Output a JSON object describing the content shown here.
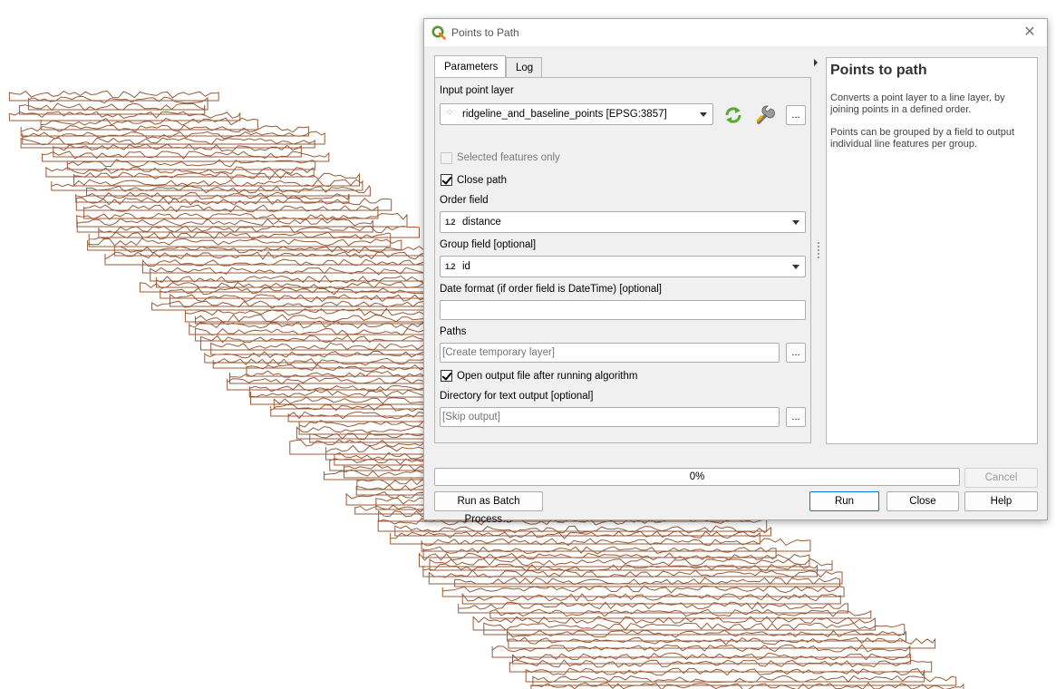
{
  "colors": {
    "profile_line": "#9a5a36",
    "qgis_green": "#589632",
    "progress_fill": "#06b025"
  },
  "map": {
    "description_icon": "map-canvas"
  },
  "dialog": {
    "title": "Points to Path",
    "close_icon": "close-icon",
    "tabs": [
      {
        "label": "Parameters",
        "active": true
      },
      {
        "label": "Log",
        "active": false
      }
    ],
    "params": {
      "input_layer_label": "Input point layer",
      "input_layer_value": "ridgeline_and_baseline_points [EPSG:3857]",
      "selected_only_label": "Selected features only",
      "selected_only_checked": false,
      "selected_only_enabled": false,
      "close_path_label": "Close path",
      "close_path_checked": true,
      "order_field_label": "Order field",
      "order_field_type": "1.2",
      "order_field_value": "distance",
      "group_field_label": "Group field [optional]",
      "group_field_type": "1.2",
      "group_field_value": "id",
      "date_format_label": "Date format (if order field is DateTime) [optional]",
      "date_format_value": "",
      "paths_label": "Paths",
      "paths_placeholder": "[Create temporary layer]",
      "open_output_label": "Open output file after running algorithm",
      "open_output_checked": true,
      "directory_label": "Directory for text output [optional]",
      "directory_placeholder": "[Skip output]",
      "ellipsis_label": "..."
    },
    "help": {
      "title": "Points to path",
      "paragraph1": "Converts a point layer to a line layer, by joining points in a defined order.",
      "paragraph2": "Points can be grouped by a field to output individual line features per group."
    },
    "progress": {
      "value": 0,
      "text": "0%"
    },
    "buttons": {
      "cancel": "Cancel",
      "batch": "Run as Batch Process…",
      "run": "Run",
      "close": "Close",
      "help": "Help"
    }
  }
}
